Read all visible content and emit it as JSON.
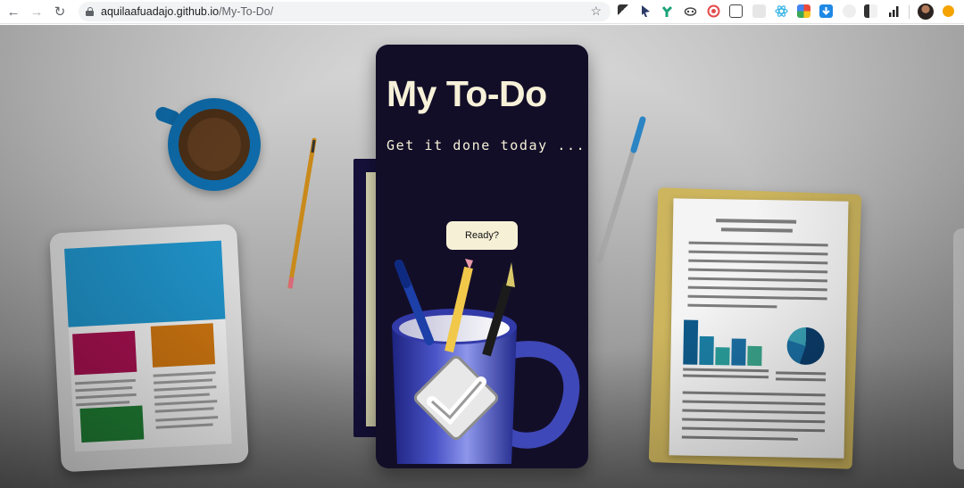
{
  "browser": {
    "url_host": "aquilaafuadajo.github.io",
    "url_path": "/My-To-Do/",
    "icons": {
      "back": "back-arrow-icon",
      "forward": "forward-arrow-icon",
      "reload": "reload-icon",
      "lock": "lock-icon",
      "bookmark": "star-icon"
    }
  },
  "app": {
    "title": "My To-Do",
    "subtitle": "Get it done today ...",
    "ready_label": "Ready?"
  },
  "colors": {
    "card_bg": "#130e28",
    "title_text": "#f6f1d8",
    "button_bg": "#f6f1d6"
  }
}
